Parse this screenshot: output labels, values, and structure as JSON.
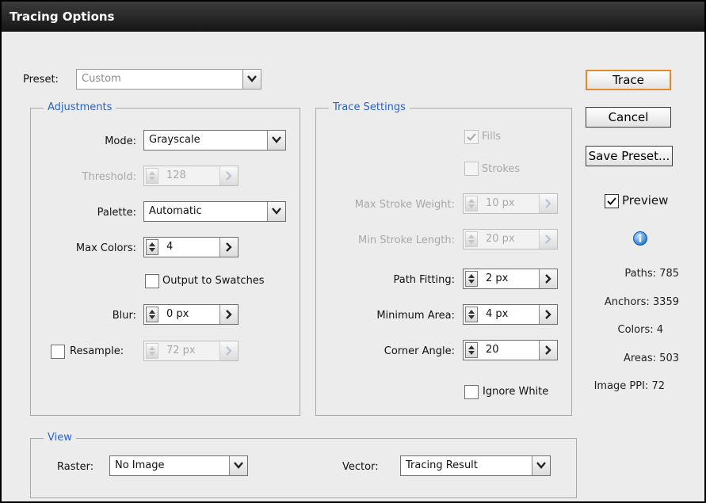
{
  "window": {
    "title": "Tracing Options"
  },
  "preset": {
    "label": "Preset:",
    "value": "Custom"
  },
  "adjustments": {
    "legend": "Adjustments",
    "mode": {
      "label": "Mode:",
      "value": "Grayscale"
    },
    "threshold": {
      "label": "Threshold:",
      "value": "128"
    },
    "palette": {
      "label": "Palette:",
      "value": "Automatic"
    },
    "max_colors": {
      "label": "Max Colors:",
      "value": "4"
    },
    "output_to_swatches": {
      "label": "Output to Swatches",
      "checked": false
    },
    "blur": {
      "label": "Blur:",
      "value": "0 px"
    },
    "resample": {
      "label": "Resample:",
      "value": "72 px",
      "checked": false
    }
  },
  "trace_settings": {
    "legend": "Trace Settings",
    "fills": {
      "label": "Fills",
      "checked": true
    },
    "strokes": {
      "label": "Strokes",
      "checked": false
    },
    "max_stroke_weight": {
      "label": "Max Stroke Weight:",
      "value": "10 px"
    },
    "min_stroke_length": {
      "label": "Min Stroke Length:",
      "value": "20 px"
    },
    "path_fitting": {
      "label": "Path Fitting:",
      "value": "2 px"
    },
    "minimum_area": {
      "label": "Minimum Area:",
      "value": "4 px"
    },
    "corner_angle": {
      "label": "Corner Angle:",
      "value": "20"
    },
    "ignore_white": {
      "label": "Ignore White",
      "checked": false
    }
  },
  "view": {
    "legend": "View",
    "raster": {
      "label": "Raster:",
      "value": "No Image"
    },
    "vector": {
      "label": "Vector:",
      "value": "Tracing Result"
    }
  },
  "buttons": {
    "trace": "Trace",
    "cancel": "Cancel",
    "save_preset": "Save Preset..."
  },
  "preview": {
    "label": "Preview",
    "checked": true
  },
  "info_icon": "info-icon",
  "stats": {
    "paths": "Paths: 785",
    "anchors": "Anchors: 3359",
    "colors": "Colors: 4",
    "areas": "Areas: 503",
    "image_ppi": "Image PPI: 72"
  },
  "colors": {
    "legend_blue": "#2a62c7",
    "default_button_border": "#e38a2b",
    "titlebar": "#1f1f1f"
  }
}
